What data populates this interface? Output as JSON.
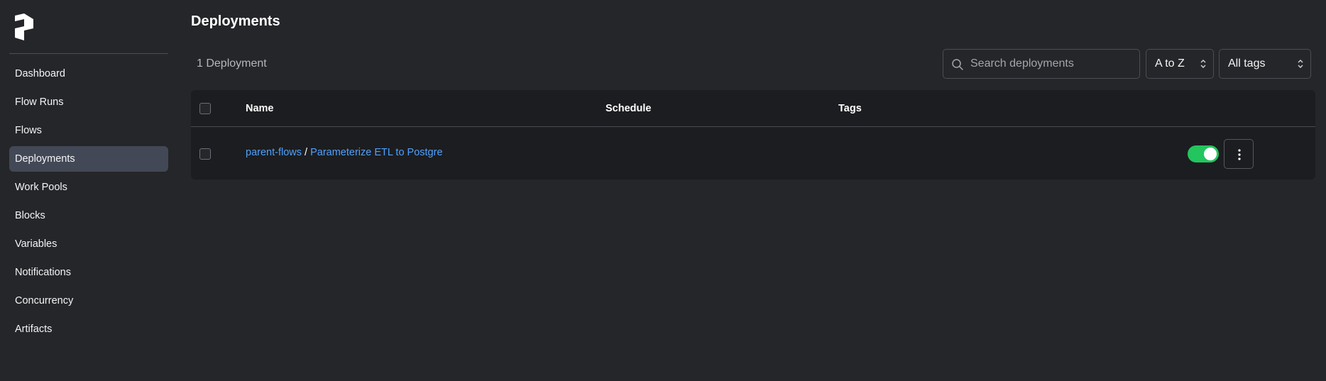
{
  "sidebar": {
    "items": [
      {
        "label": "Dashboard"
      },
      {
        "label": "Flow Runs"
      },
      {
        "label": "Flows"
      },
      {
        "label": "Deployments",
        "active": true
      },
      {
        "label": "Work Pools"
      },
      {
        "label": "Blocks"
      },
      {
        "label": "Variables"
      },
      {
        "label": "Notifications"
      },
      {
        "label": "Concurrency"
      },
      {
        "label": "Artifacts"
      }
    ]
  },
  "header": {
    "title": "Deployments"
  },
  "toolbar": {
    "count_label": "1 Deployment",
    "search_placeholder": "Search deployments",
    "sort_value": "A to Z",
    "tags_value": "All tags"
  },
  "table": {
    "columns": [
      "Name",
      "Schedule",
      "Tags"
    ],
    "rows": [
      {
        "flow_name": "parent-flows",
        "separator": "/",
        "deployment_name": "Parameterize ETL to Postgre",
        "schedule": "",
        "tags": "",
        "enabled": true
      }
    ]
  },
  "colors": {
    "background": "#252629",
    "table_background": "#1c1d20",
    "active_nav": "#434856",
    "link": "#4ea1ff",
    "toggle_on": "#22c55e"
  },
  "icons": {
    "logo": "prefect-logo",
    "search": "search-icon",
    "chevron": "chevron-up-down-icon",
    "menu": "kebab-menu-icon"
  }
}
